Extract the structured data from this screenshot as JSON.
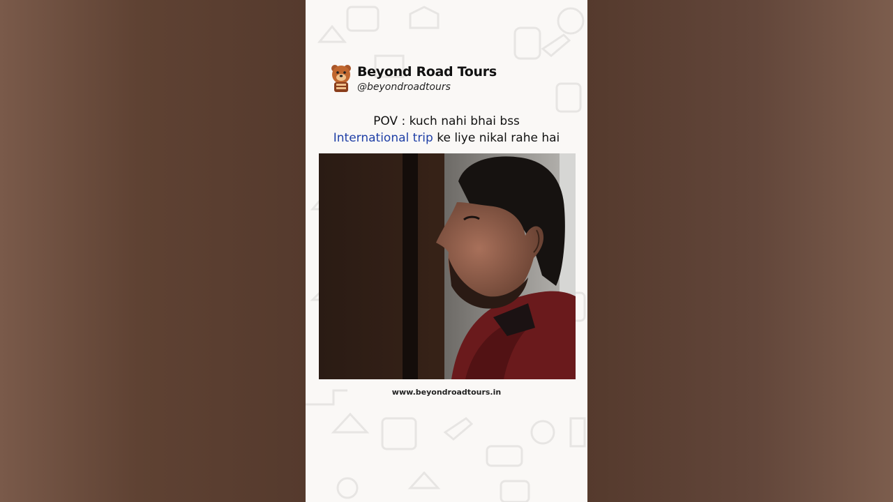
{
  "brand": {
    "name": "Beyond Road Tours",
    "handle": "@beyondroadtours",
    "logo_icon": "bear-mascot-icon"
  },
  "caption": {
    "line1": "POV : kuch nahi bhai bss",
    "line2_highlight": "International trip",
    "line2_rest": " ke liye nikal rahe hai",
    "highlight_color": "#1f3fa6"
  },
  "video_frame": {
    "subject": "man-in-red-sweater"
  },
  "footer": {
    "website": "www.beyondroadtours.in"
  }
}
